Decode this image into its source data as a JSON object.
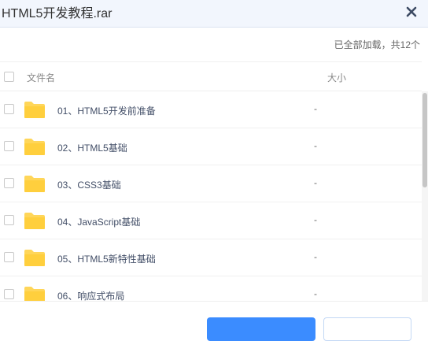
{
  "window": {
    "title": "HTML5开发教程.rar",
    "close_icon": "close-icon"
  },
  "status": "已全部加载，共12个",
  "columns": {
    "name": "文件名",
    "size": "大小"
  },
  "rows": [
    {
      "name": "01、HTML5开发前准备",
      "size": "-",
      "icon": "folder-icon"
    },
    {
      "name": "02、HTML5基础",
      "size": "-",
      "icon": "folder-icon"
    },
    {
      "name": "03、CSS3基础",
      "size": "-",
      "icon": "folder-icon"
    },
    {
      "name": "04、JavaScript基础",
      "size": "-",
      "icon": "folder-icon"
    },
    {
      "name": "05、HTML5新特性基础",
      "size": "-",
      "icon": "folder-icon"
    },
    {
      "name": "06、响应式布局",
      "size": "-",
      "icon": "folder-icon"
    }
  ],
  "colors": {
    "title_bar": "#f2f6fd",
    "folder": "#ffd659",
    "accent": "#3b8cff"
  }
}
